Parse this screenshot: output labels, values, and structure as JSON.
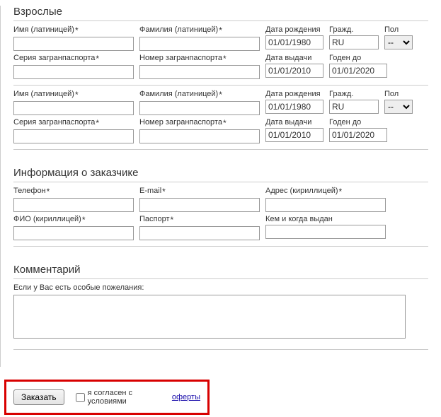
{
  "adults": {
    "title": "Взрослые",
    "blocks": [
      {
        "name_label": "Имя (латиницей)",
        "surname_label": "Фамилия (латиницей)",
        "dob_label": "Дата рождения",
        "dob_value": "01/01/1980",
        "nat_label": "Гражд.",
        "nat_value": "RU",
        "sex_label": "Пол",
        "sex_value": "--",
        "series_label": "Серия загранпаспорта",
        "number_label": "Номер загранпаспорта",
        "issue_label": "Дата выдачи",
        "issue_value": "01/01/2010",
        "valid_label": "Годен до",
        "valid_value": "01/01/2020"
      },
      {
        "name_label": "Имя (латиницей)",
        "surname_label": "Фамилия (латиницей)",
        "dob_label": "Дата рождения",
        "dob_value": "01/01/1980",
        "nat_label": "Гражд.",
        "nat_value": "RU",
        "sex_label": "Пол",
        "sex_value": "--",
        "series_label": "Серия загранпаспорта",
        "number_label": "Номер загранпаспорта",
        "issue_label": "Дата выдачи",
        "issue_value": "01/01/2010",
        "valid_label": "Годен до",
        "valid_value": "01/01/2020"
      }
    ]
  },
  "customer": {
    "title": "Информация о заказчике",
    "phone_label": "Телефон",
    "email_label": "E-mail",
    "address_label": "Адрес (кириллицей)",
    "fio_label": "ФИО (кириллицей)",
    "passport_label": "Паспорт",
    "issued_label": "Кем и когда выдан"
  },
  "comment": {
    "title": "Комментарий",
    "hint": "Если у Вас есть особые пожелания:"
  },
  "footer": {
    "order": "Заказать",
    "agree_prefix": "я согласен с условиями ",
    "oferta": "оферты"
  },
  "star": "*"
}
